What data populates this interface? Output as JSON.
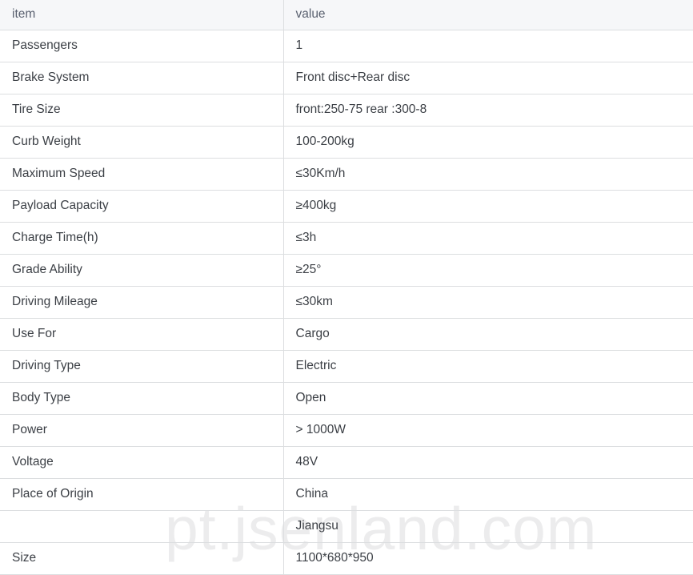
{
  "table": {
    "headers": {
      "item": "item",
      "value": "value"
    },
    "rows": [
      {
        "item": "Passengers",
        "value": "1"
      },
      {
        "item": "Brake System",
        "value": "Front disc+Rear disc"
      },
      {
        "item": "Tire Size",
        "value": "front:250-75 rear :300-8"
      },
      {
        "item": "Curb Weight",
        "value": "100-200kg"
      },
      {
        "item": "Maximum Speed",
        "value": "≤30Km/h"
      },
      {
        "item": "Payload Capacity",
        "value": "≥400kg"
      },
      {
        "item": "Charge Time(h)",
        "value": "≤3h"
      },
      {
        "item": "Grade Ability",
        "value": "≥25°"
      },
      {
        "item": "Driving Mileage",
        "value": "≤30km"
      },
      {
        "item": "Use For",
        "value": "Cargo"
      },
      {
        "item": "Driving Type",
        "value": "Electric"
      },
      {
        "item": "Body Type",
        "value": "Open"
      },
      {
        "item": "Power",
        "value": "> 1000W"
      },
      {
        "item": "Voltage",
        "value": "48V"
      },
      {
        "item": "Place of Origin",
        "value": "China"
      },
      {
        "item": "",
        "value": "Jiangsu"
      },
      {
        "item": "Size",
        "value": "1100*680*950"
      }
    ]
  },
  "watermark": {
    "text": "pt.jsenland.com"
  },
  "colors": {
    "header_background": "#f6f7f9",
    "header_text": "#5a6170",
    "body_text": "#3b3f45",
    "border": "#dcdee0",
    "watermark_text": "#ececed",
    "page_background": "#ffffff"
  }
}
